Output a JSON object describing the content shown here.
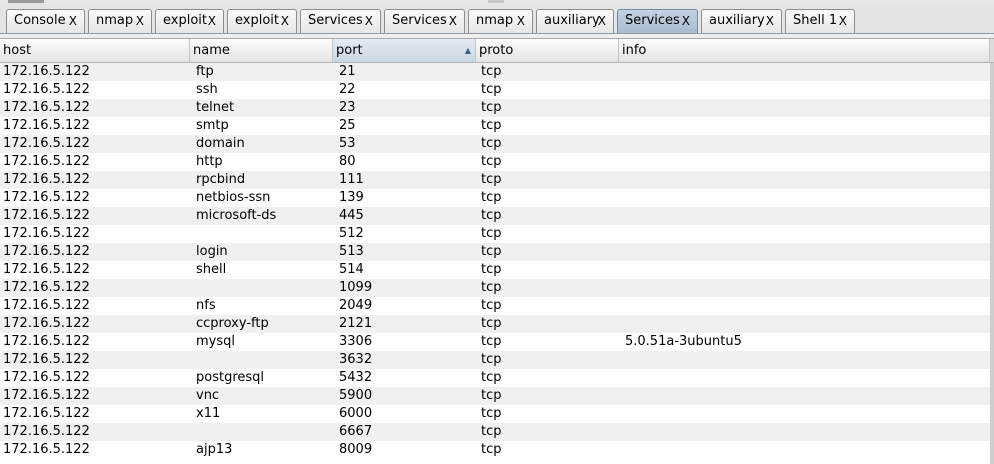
{
  "tabs": [
    {
      "label": "Console",
      "close": "X",
      "active": false
    },
    {
      "label": "nmap",
      "close": "X",
      "active": false
    },
    {
      "label": "exploit",
      "close": "X",
      "active": false
    },
    {
      "label": "exploit",
      "close": "X",
      "active": false
    },
    {
      "label": "Services",
      "close": "X",
      "active": false
    },
    {
      "label": "Services",
      "close": "X",
      "active": false
    },
    {
      "label": "nmap",
      "close": "X",
      "active": false
    },
    {
      "label": "auxiliary",
      "close": "X",
      "active": false
    },
    {
      "label": "Services",
      "close": "X",
      "active": true
    },
    {
      "label": "auxiliary",
      "close": "X",
      "active": false
    },
    {
      "label": "Shell 1",
      "close": "X",
      "active": false
    }
  ],
  "table": {
    "columns": [
      "host",
      "name",
      "port",
      "proto",
      "info"
    ],
    "sort": {
      "column": "port",
      "direction": "ascending",
      "indicator": "▲"
    },
    "rows": [
      [
        "172.16.5.122",
        "ftp",
        "21",
        "tcp",
        ""
      ],
      [
        "172.16.5.122",
        "ssh",
        "22",
        "tcp",
        ""
      ],
      [
        "172.16.5.122",
        "telnet",
        "23",
        "tcp",
        ""
      ],
      [
        "172.16.5.122",
        "smtp",
        "25",
        "tcp",
        ""
      ],
      [
        "172.16.5.122",
        "domain",
        "53",
        "tcp",
        ""
      ],
      [
        "172.16.5.122",
        "http",
        "80",
        "tcp",
        ""
      ],
      [
        "172.16.5.122",
        "rpcbind",
        "111",
        "tcp",
        ""
      ],
      [
        "172.16.5.122",
        "netbios-ssn",
        "139",
        "tcp",
        ""
      ],
      [
        "172.16.5.122",
        "microsoft-ds",
        "445",
        "tcp",
        ""
      ],
      [
        "172.16.5.122",
        "",
        "512",
        "tcp",
        ""
      ],
      [
        "172.16.5.122",
        "login",
        "513",
        "tcp",
        ""
      ],
      [
        "172.16.5.122",
        "shell",
        "514",
        "tcp",
        ""
      ],
      [
        "172.16.5.122",
        "",
        "1099",
        "tcp",
        ""
      ],
      [
        "172.16.5.122",
        "nfs",
        "2049",
        "tcp",
        ""
      ],
      [
        "172.16.5.122",
        "ccproxy-ftp",
        "2121",
        "tcp",
        ""
      ],
      [
        "172.16.5.122",
        "mysql",
        "3306",
        "tcp",
        "5.0.51a-3ubuntu5"
      ],
      [
        "172.16.5.122",
        "",
        "3632",
        "tcp",
        ""
      ],
      [
        "172.16.5.122",
        "postgresql",
        "5432",
        "tcp",
        ""
      ],
      [
        "172.16.5.122",
        "vnc",
        "5900",
        "tcp",
        ""
      ],
      [
        "172.16.5.122",
        "x11",
        "6000",
        "tcp",
        ""
      ],
      [
        "172.16.5.122",
        "",
        "6667",
        "tcp",
        ""
      ],
      [
        "172.16.5.122",
        "ajp13",
        "8009",
        "tcp",
        ""
      ]
    ]
  }
}
